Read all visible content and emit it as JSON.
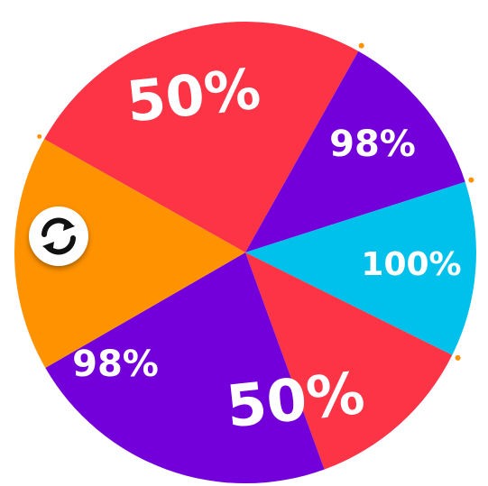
{
  "wheel": {
    "segments": [
      {
        "label": "50%",
        "color": "#fd3346"
      },
      {
        "label": "98%",
        "color": "#7300da"
      },
      {
        "label": "100%",
        "color": "#00c1ec"
      },
      {
        "label": "50%",
        "color": "#fd3346"
      },
      {
        "label": "98%",
        "color": "#7300da"
      },
      {
        "label": "",
        "color": "#fe9201"
      }
    ],
    "peg_color": "#fe9201"
  },
  "spin_button": {
    "icon": "refresh-icon"
  }
}
